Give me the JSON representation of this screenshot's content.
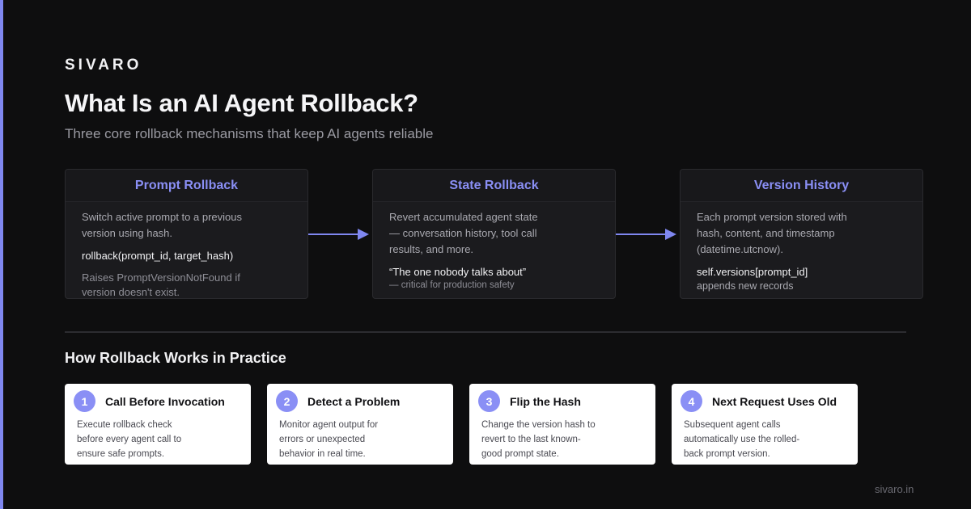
{
  "brand": "SIVARO",
  "title": "What Is an AI Agent Rollback?",
  "subtitle": "Three core rollback mechanisms that keep AI agents reliable",
  "cards": [
    {
      "title": "Prompt Rollback",
      "desc": "Switch active prompt to a previous version using hash.",
      "code": "rollback(prompt_id, target_hash)",
      "note": "Raises PromptVersionNotFound if version doesn't exist."
    },
    {
      "title": "State Rollback",
      "desc": "Revert accumulated agent state — conversation history, tool call results, and more.",
      "code": "“The one nobody talks about”",
      "note": "— critical for production safety"
    },
    {
      "title": "Version History",
      "desc": "Each prompt version stored with hash, content, and timestamp (datetime.utcnow).",
      "code": "self.versions[prompt_id]",
      "note": "appends new records"
    }
  ],
  "section_title": "How Rollback Works in Practice",
  "steps": [
    {
      "num": "1",
      "title": "Call Before Invocation",
      "desc": "Execute rollback check before every agent call to ensure safe prompts."
    },
    {
      "num": "2",
      "title": "Detect a Problem",
      "desc": "Monitor agent output for errors or unexpected behavior in real time."
    },
    {
      "num": "3",
      "title": "Flip the Hash",
      "desc": "Change the version hash to revert to the last known-good prompt state."
    },
    {
      "num": "4",
      "title": "Next Request Uses Old",
      "desc": "Subsequent agent calls automatically use the rolled-back prompt version."
    }
  ],
  "footer": "sivaro.in",
  "colors": {
    "accent": "#8a8ff5",
    "background": "#0e0e0f",
    "card": "#1b1b1e",
    "step_card": "#ffffff"
  }
}
